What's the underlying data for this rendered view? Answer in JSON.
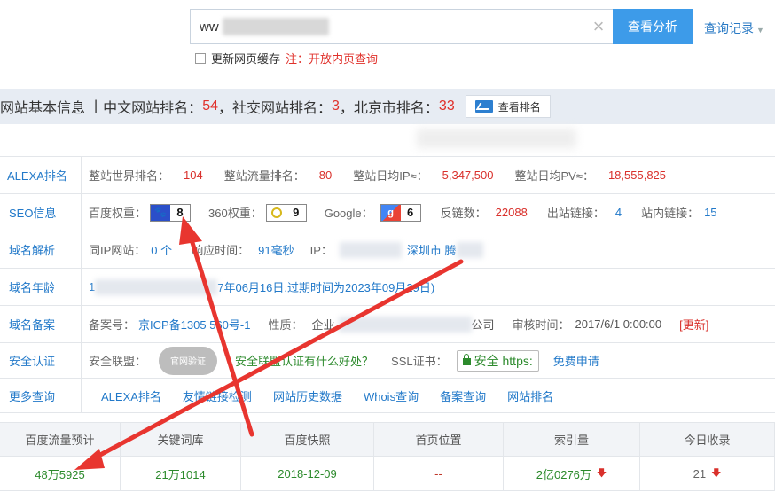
{
  "search": {
    "value": "ww",
    "clear_icon": "close-icon",
    "button_label": "查看分析",
    "history_label": "查询记录"
  },
  "cache": {
    "label": "更新网页缓存",
    "note": "注：开放内页查询"
  },
  "infobar": {
    "title": "网站基本信息",
    "sep": "|",
    "cn_label": "中文网站排名：",
    "cn_rank": "54",
    "social_label": "，社交网站排名：",
    "social_rank": "3",
    "city_label": "，北京市排名：",
    "city_rank": "33",
    "rank_button": "查看排名"
  },
  "rows": {
    "alexa": {
      "label": "ALEXA排名",
      "world_k": "整站世界排名：",
      "world_v": "104",
      "traffic_k": "整站流量排名：",
      "traffic_v": "80",
      "ip_k": "整站日均IP≈：",
      "ip_v": "5,347,500",
      "pv_k": "整站日均PV≈：",
      "pv_v": "18,555,825"
    },
    "seo": {
      "label": "SEO信息",
      "baidu_k": "百度权重：",
      "baidu_v": "8",
      "s360_k": "360权重：",
      "s360_v": "9",
      "google_k": "Google：",
      "google_v": "6",
      "backlinks_k": "反链数：",
      "backlinks_v": "22088",
      "outlinks_k": "出站链接：",
      "outlinks_v": "4",
      "inlinks_k": "站内链接：",
      "inlinks_v": "15"
    },
    "dns": {
      "label": "域名解析",
      "sameip_k": "同IP网站：",
      "sameip_v": "0 个",
      "resp_k": "响应时间：",
      "resp_v": "91毫秒",
      "ip_k": "IP：",
      "ip_loc": "深圳市 腾"
    },
    "age": {
      "label": "域名年龄",
      "prefix": "1",
      "text": "7年06月16日,过期时间为2023年09月29日)"
    },
    "icp": {
      "label": "域名备案",
      "num_k": "备案号：",
      "num_v": "京ICP备1305 560号-1",
      "type_k": "性质：",
      "type_v": "企业",
      "company_v": "公司",
      "time_k": "审核时间：",
      "time_v": "2017/6/1 0:00:00",
      "update": "[更新]"
    },
    "security": {
      "label": "安全认证",
      "union_k": "安全联盟：",
      "seal_text": "官网验证",
      "union_link": "安全联盟认证有什么好处？",
      "ssl_k": "SSL证书：",
      "ssl_text": "安全 https:",
      "ssl_apply": "免费申请"
    },
    "more": {
      "label": "更多查询",
      "links": [
        "ALEXA排名",
        "友情链接检测",
        "网站历史数据",
        "Whois查询",
        "备案查询",
        "网站排名"
      ]
    }
  },
  "stats": {
    "headers": [
      "百度流量预计",
      "关键词库",
      "百度快照",
      "首页位置",
      "索引量",
      "今日收录"
    ],
    "values": [
      "48万5925",
      "21万1014",
      "2018-12-09",
      "--",
      "2亿0276万",
      "21"
    ]
  },
  "colors": {
    "accent": "#3d9be9",
    "red": "#e0312b",
    "arrow": "#e8352f"
  }
}
